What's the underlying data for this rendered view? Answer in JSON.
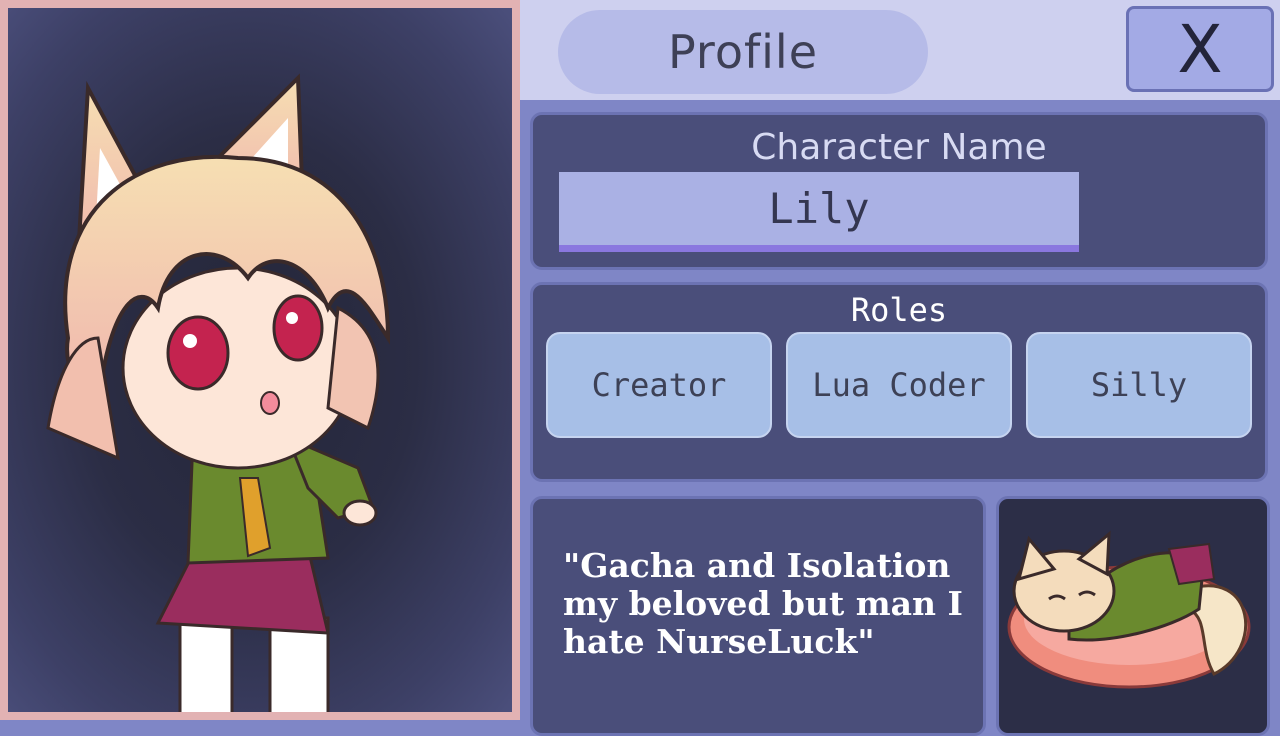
{
  "header": {
    "title": "Profile",
    "close_label": "X"
  },
  "character_name": {
    "label": "Character Name",
    "value": "Lily"
  },
  "roles": {
    "label": "Roles",
    "items": [
      {
        "label": "Creator"
      },
      {
        "label": "Lua Coder"
      },
      {
        "label": "Silly"
      }
    ]
  },
  "bio": {
    "text": "\"Gacha and Isolation my beloved but man I hate NurseLuck\""
  },
  "icons": {
    "portrait": "character-portrait",
    "sleeping": "sleeping-character-image"
  }
}
